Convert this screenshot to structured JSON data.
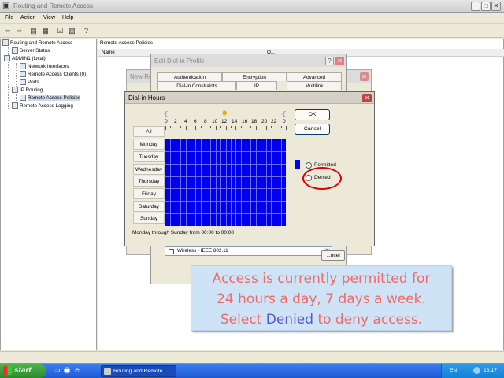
{
  "window": {
    "title": "Routing and Remote Access",
    "menu": [
      "File",
      "Action",
      "View",
      "Help"
    ]
  },
  "tree": {
    "items": [
      {
        "label": "Routing and Remote Access",
        "icon": "server-icon"
      },
      {
        "label": "Server Status",
        "icon": "status-icon"
      },
      {
        "label": "ADMIN1 (local)",
        "icon": "computer-icon"
      },
      {
        "label": "Network Interfaces",
        "icon": "network-icon"
      },
      {
        "label": "Remote Access Clients (0)",
        "icon": "clients-icon"
      },
      {
        "label": "Ports",
        "icon": "ports-icon"
      },
      {
        "label": "IP Routing",
        "icon": "routing-icon"
      },
      {
        "label": "Remote Access Policies",
        "icon": "policy-icon"
      },
      {
        "label": "Remote Access Logging",
        "icon": "log-icon"
      }
    ]
  },
  "list": {
    "header": "Remote Access Policies",
    "columns": [
      "Name",
      "O..."
    ]
  },
  "new_policy_dialog": {
    "title": "New Rem...",
    "cancel_label": "...ncel"
  },
  "edit_profile": {
    "title": "Edit Dial-in Profile",
    "tabs_top": [
      "Authentication",
      "Encryption",
      "Advanced"
    ],
    "tabs_bottom": [
      "Dial-in Constraints",
      "IP",
      "Multilink"
    ],
    "media_item": "Wireless - IEEE 802.11"
  },
  "dial_in_hours": {
    "title": "Dial-in Hours",
    "ok_label": "OK",
    "cancel_label": "Cancel",
    "all_label": "All",
    "days": [
      "Monday",
      "Tuesday",
      "Wednesday",
      "Thursday",
      "Friday",
      "Saturday",
      "Sunday"
    ],
    "hour_labels": [
      "0",
      "2",
      "4",
      "6",
      "8",
      "10",
      "12",
      "14",
      "16",
      "18",
      "20",
      "22",
      "0"
    ],
    "permitted_label": "Permitted",
    "denied_label": "Denied",
    "selected": "Permitted",
    "summary": "Monday through Sunday from 00:00 to 00:00",
    "permitted_color": "#0000ee"
  },
  "callout": {
    "line1": "Access is currently permitted for",
    "line2": "24 hours a day, 7 days a week.",
    "line3_pre": "Select ",
    "line3_highlight": "Denied",
    "line3_post": " to deny access.",
    "text_color": "#f06a6a",
    "highlight_color": "#5b5bd0"
  },
  "taskbar": {
    "start_label": "start",
    "task_label": "Routing and Remote ...",
    "lang": "EN",
    "clock": "18:17"
  }
}
